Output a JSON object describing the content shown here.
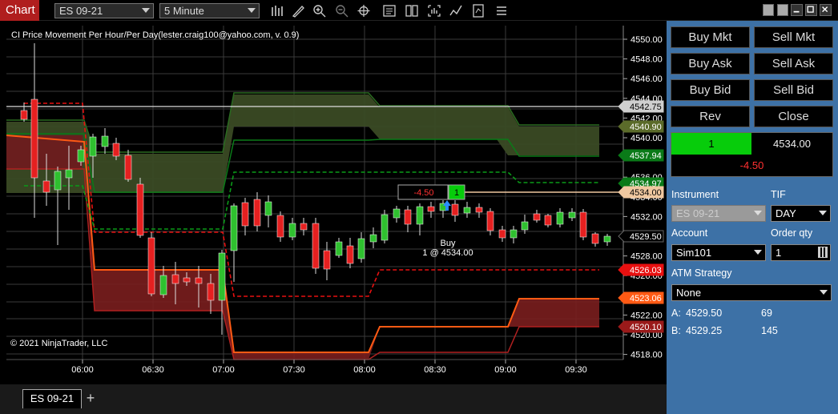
{
  "toolbar": {
    "chart_tab": "Chart",
    "instrument": "ES 09-21",
    "interval": "5 Minute",
    "icons": [
      "bar-type-icon",
      "draw-tool-icon",
      "zoom-in-icon",
      "zoom-out-icon",
      "crosshair-icon",
      "data-box-icon",
      "templates-icon",
      "properties-icon",
      "indicators-icon",
      "strategies-icon",
      "chart-trader-icon"
    ]
  },
  "chart": {
    "title": "CI Price Movement Per Hour/Per Day(lester.craig100@yahoo.com, v. 0.9)",
    "copyright": "© 2021 NinjaTrader, LLC",
    "price_labels": [
      "4550.00",
      "4548.00",
      "4546.00",
      "4544.00",
      "4542.00",
      "4540.00",
      "4538.00",
      "4536.00",
      "4534.00",
      "4532.00",
      "4530.00",
      "4528.00",
      "4526.00",
      "4524.00",
      "4522.00",
      "4520.00",
      "4518.00"
    ],
    "time_labels": [
      "06:00",
      "06:30",
      "07:00",
      "07:30",
      "08:00",
      "08:30",
      "09:00",
      "09:30"
    ],
    "axis_markers": [
      {
        "text": "4542.75",
        "color": "#cfcfcf",
        "fg": "#000"
      },
      {
        "text": "4540.90",
        "color": "#5b6b2a",
        "fg": "#fff"
      },
      {
        "text": "4537.94",
        "color": "#0a7a18",
        "fg": "#fff"
      },
      {
        "text": "4534.97",
        "color": "#0a7a18",
        "fg": "#fff"
      },
      {
        "text": "4534.00",
        "color": "#f0c8a0",
        "fg": "#000"
      },
      {
        "text": "4529.50",
        "color": "#000",
        "fg": "#fff"
      },
      {
        "text": "4526.03",
        "color": "#e81010",
        "fg": "#fff"
      },
      {
        "text": "4523.06",
        "color": "#ff5a14",
        "fg": "#fff"
      },
      {
        "text": "4520.10",
        "color": "#9a1a1a",
        "fg": "#fff"
      }
    ],
    "position_flag": {
      "pnl": "-4.50",
      "qty": "1"
    },
    "buy_marker": {
      "line1": "Buy",
      "line2": "1 @ 4534.00"
    }
  },
  "bottom": {
    "tab": "ES 09-21",
    "add": "+"
  },
  "panel": {
    "buttons": [
      "Buy Mkt",
      "Sell Mkt",
      "Buy Ask",
      "Sell Ask",
      "Buy Bid",
      "Sell Bid",
      "Rev",
      "Close"
    ],
    "position": {
      "qty": "1",
      "price": "4534.00",
      "pnl": "-4.50"
    },
    "instrument_label": "Instrument",
    "instrument_value": "ES 09-21",
    "tif_label": "TIF",
    "tif_value": "DAY",
    "account_label": "Account",
    "account_value": "Sim101",
    "qty_label": "Order qty",
    "qty_value": "1",
    "atm_label": "ATM Strategy",
    "atm_value": "None",
    "ask_label": "A:",
    "ask_price": "4529.50",
    "ask_size": "69",
    "bid_label": "B:",
    "bid_price": "4529.25",
    "bid_size": "145"
  }
}
